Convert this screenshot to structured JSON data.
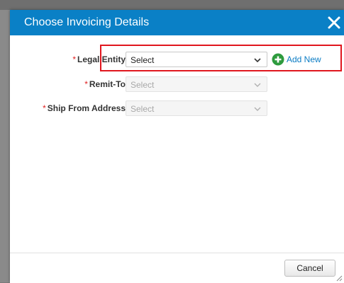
{
  "dialog": {
    "title": "Choose Invoicing Details",
    "close_icon": "close-icon"
  },
  "fields": [
    {
      "label": "Legal Entity",
      "required_mark": "*",
      "value": "Select",
      "disabled": false
    },
    {
      "label": "Remit-To",
      "required_mark": "*",
      "value": "Select",
      "disabled": true
    },
    {
      "label": "Ship From Address",
      "required_mark": "*",
      "value": "Select",
      "disabled": true
    }
  ],
  "add_new": {
    "label": "Add New",
    "icon": "plus-circle-icon"
  },
  "footer": {
    "cancel_label": "Cancel"
  },
  "colors": {
    "header": "#0a80c6",
    "highlight": "#e0161e",
    "add_icon": "#2e9b3e",
    "link": "#0a7cc4",
    "required": "#e02020"
  }
}
